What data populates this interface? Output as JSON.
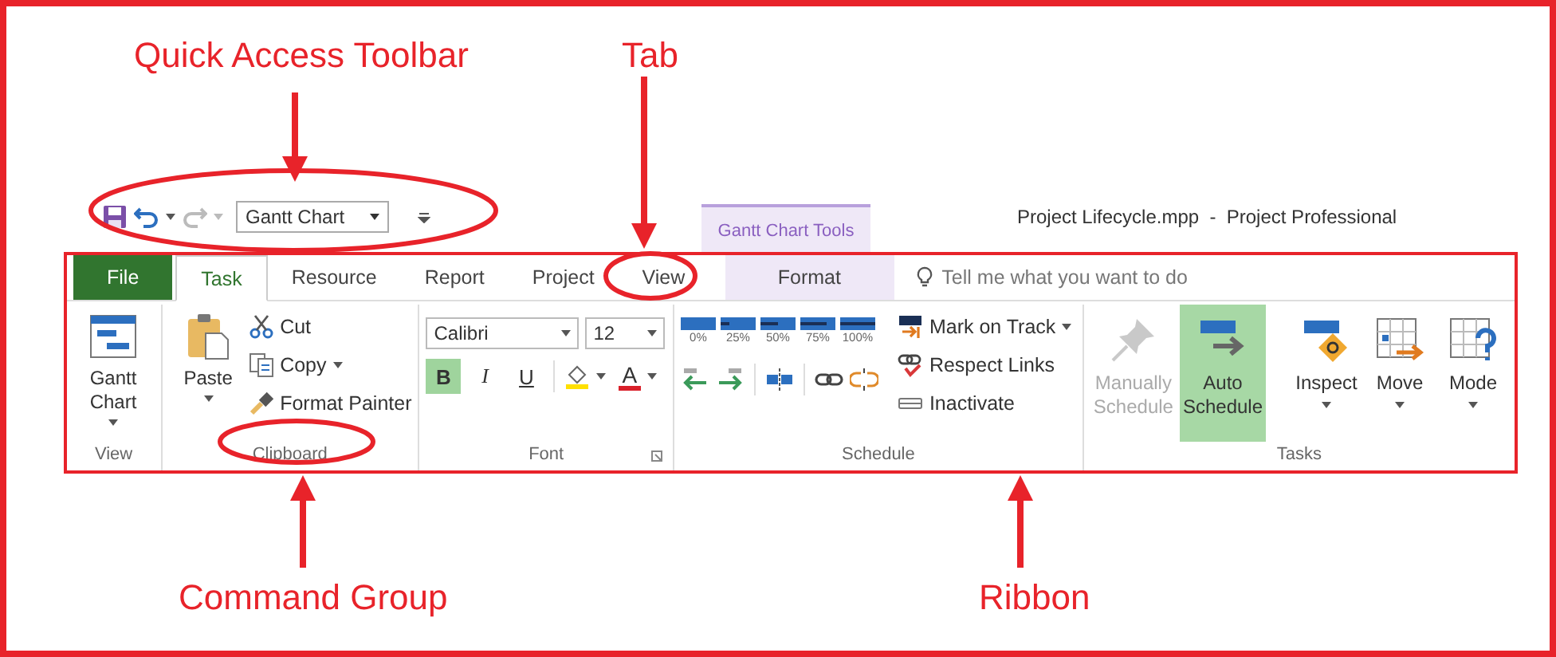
{
  "annotations": [
    {
      "label": "Quick Access Toolbar"
    },
    {
      "label": "Tab"
    },
    {
      "label": "Command Group"
    },
    {
      "label": "Ribbon"
    }
  ],
  "quick_access_toolbar": {
    "view_selector": "Gantt Chart"
  },
  "contextual_tab_group": "Gantt Chart Tools",
  "window": {
    "title": "Project Lifecycle.mpp  -  Project Professional"
  },
  "tabs": [
    {
      "label": "File",
      "kind": "file",
      "selected": false
    },
    {
      "label": "Task",
      "kind": "normal",
      "selected": true
    },
    {
      "label": "Resource",
      "kind": "normal",
      "selected": false
    },
    {
      "label": "Report",
      "kind": "normal",
      "selected": false
    },
    {
      "label": "Project",
      "kind": "normal",
      "selected": false
    },
    {
      "label": "View",
      "kind": "normal",
      "selected": false
    },
    {
      "label": "Format",
      "kind": "contextual",
      "selected": false
    }
  ],
  "tell_me": {
    "placeholder": "Tell me what you want to do"
  },
  "ribbon": {
    "view": {
      "name": "View",
      "button": "Gantt Chart"
    },
    "clipboard": {
      "name": "Clipboard",
      "paste": "Paste",
      "commands": [
        "Cut",
        "Copy",
        "Format Painter"
      ]
    },
    "font": {
      "name": "Font",
      "family": "Calibri",
      "size": "12",
      "format_buttons": [
        {
          "label": "B",
          "selected": true
        },
        {
          "label": "I",
          "selected": false
        },
        {
          "label": "U",
          "selected": false
        }
      ],
      "font_color": "A"
    },
    "schedule": {
      "name": "Schedule",
      "percent_buttons": [
        "0%",
        "25%",
        "50%",
        "75%",
        "100%"
      ],
      "commands": [
        "Mark on Track",
        "Respect Links",
        "Inactivate"
      ]
    },
    "tasks": {
      "name": "Tasks",
      "buttons": [
        {
          "label": "Manually Schedule",
          "kind": "manual",
          "disabled": true,
          "selected": false
        },
        {
          "label": "Auto Schedule",
          "kind": "auto",
          "disabled": false,
          "selected": true
        },
        {
          "label": "Inspect",
          "kind": "inspect",
          "disabled": false,
          "selected": false
        },
        {
          "label": "Move",
          "kind": "move",
          "disabled": false,
          "selected": false
        },
        {
          "label": "Mode",
          "kind": "mode",
          "disabled": false,
          "selected": false
        }
      ]
    }
  }
}
